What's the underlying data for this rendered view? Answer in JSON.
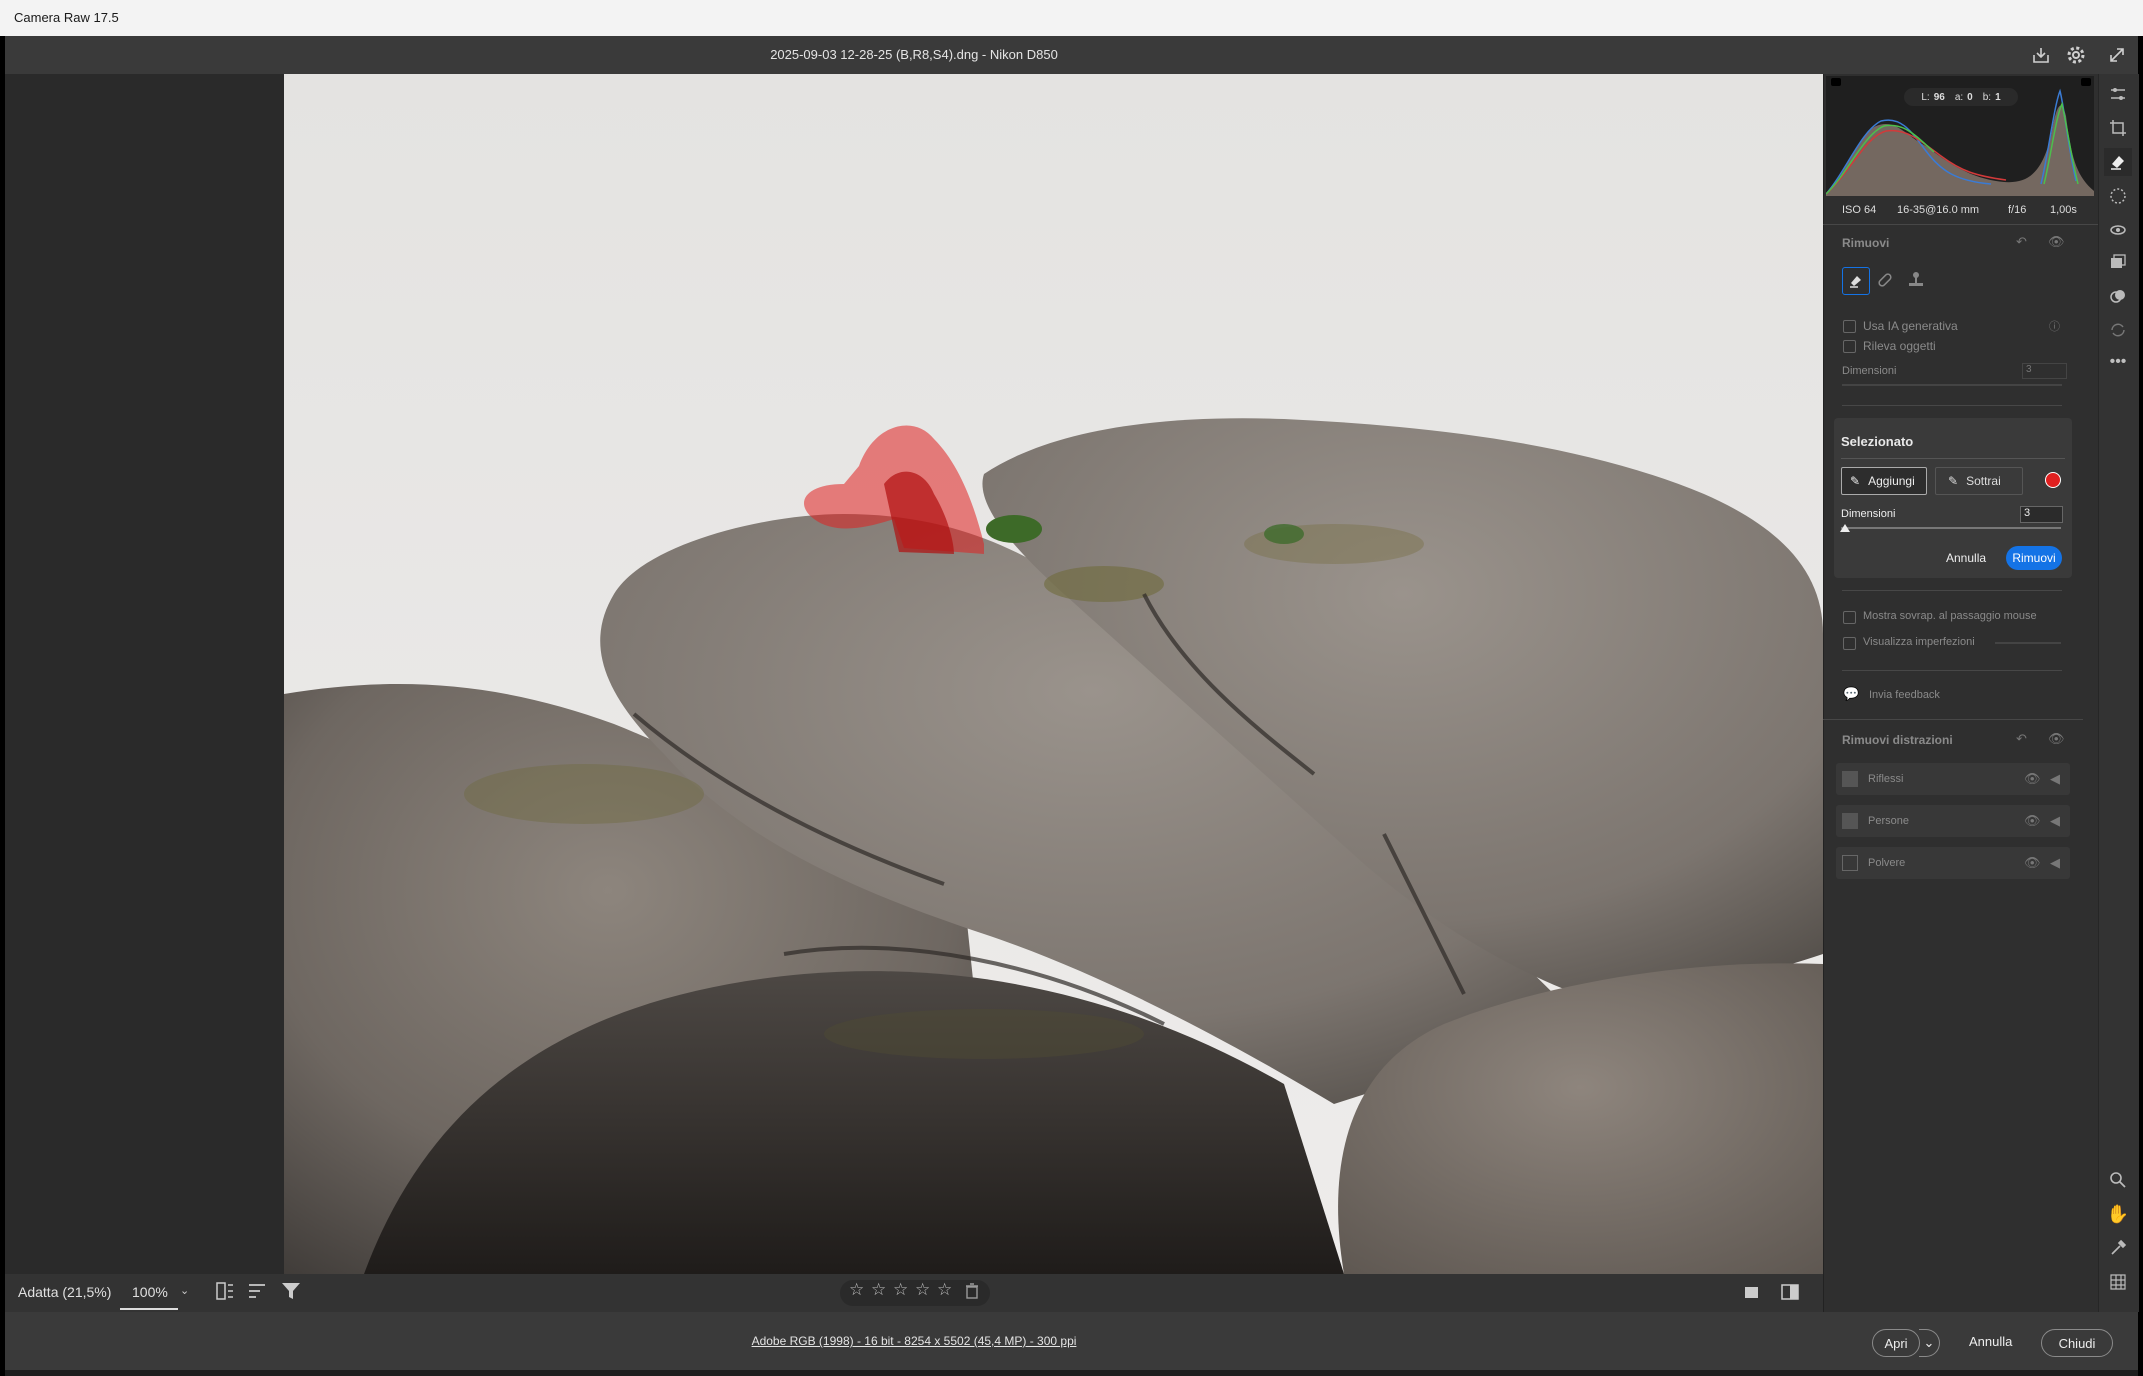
{
  "app": {
    "title": "Camera Raw 17.5"
  },
  "header": {
    "file_title": "2025-09-03 12-28-25 (B,R8,S4).dng  -  Nikon D850"
  },
  "icons": {
    "save": "download-icon",
    "settings": "gear-icon",
    "fullscreen": "expand-icon"
  },
  "histogram": {
    "readout": {
      "L_label": "L:",
      "L": "96",
      "a_label": "a:",
      "a": "0",
      "b_label": "b:",
      "b": "1"
    },
    "meta": {
      "iso": "ISO 64",
      "lens": "16-35@16.0 mm",
      "aperture": "f/16",
      "shutter": "1,00s"
    }
  },
  "remove_panel": {
    "title": "Rimuovi",
    "use_ai": "Usa IA generativa",
    "detect_objects": "Rileva oggetti",
    "size_label": "Dimensioni",
    "size_value": "3",
    "selected": {
      "title": "Selezionato",
      "add": "Aggiungi",
      "subtract": "Sottrai",
      "size_label": "Dimensioni",
      "size_value": "3",
      "cancel": "Annulla",
      "remove": "Rimuovi",
      "overlay_color": "#e02020"
    },
    "show_overlay": "Mostra sovrap. al passaggio mouse",
    "visualize": "Visualizza imperfezioni",
    "feedback": "Invia feedback"
  },
  "distractions": {
    "title": "Rimuovi distrazioni",
    "items": [
      {
        "label": "Riflessi"
      },
      {
        "label": "Persone"
      },
      {
        "label": "Polvere"
      }
    ]
  },
  "bottom": {
    "zoom_fit": "Adatta (21,5%)",
    "zoom_value": "100%"
  },
  "footer": {
    "file_info": "Adobe RGB (1998) - 16 bit - 8254 x 5502 (45,4 MP) - 300 ppi",
    "open": "Apri",
    "cancel": "Annulla",
    "close": "Chiudi"
  },
  "colors": {
    "accent": "#1473e6",
    "mask": "#e02020"
  }
}
